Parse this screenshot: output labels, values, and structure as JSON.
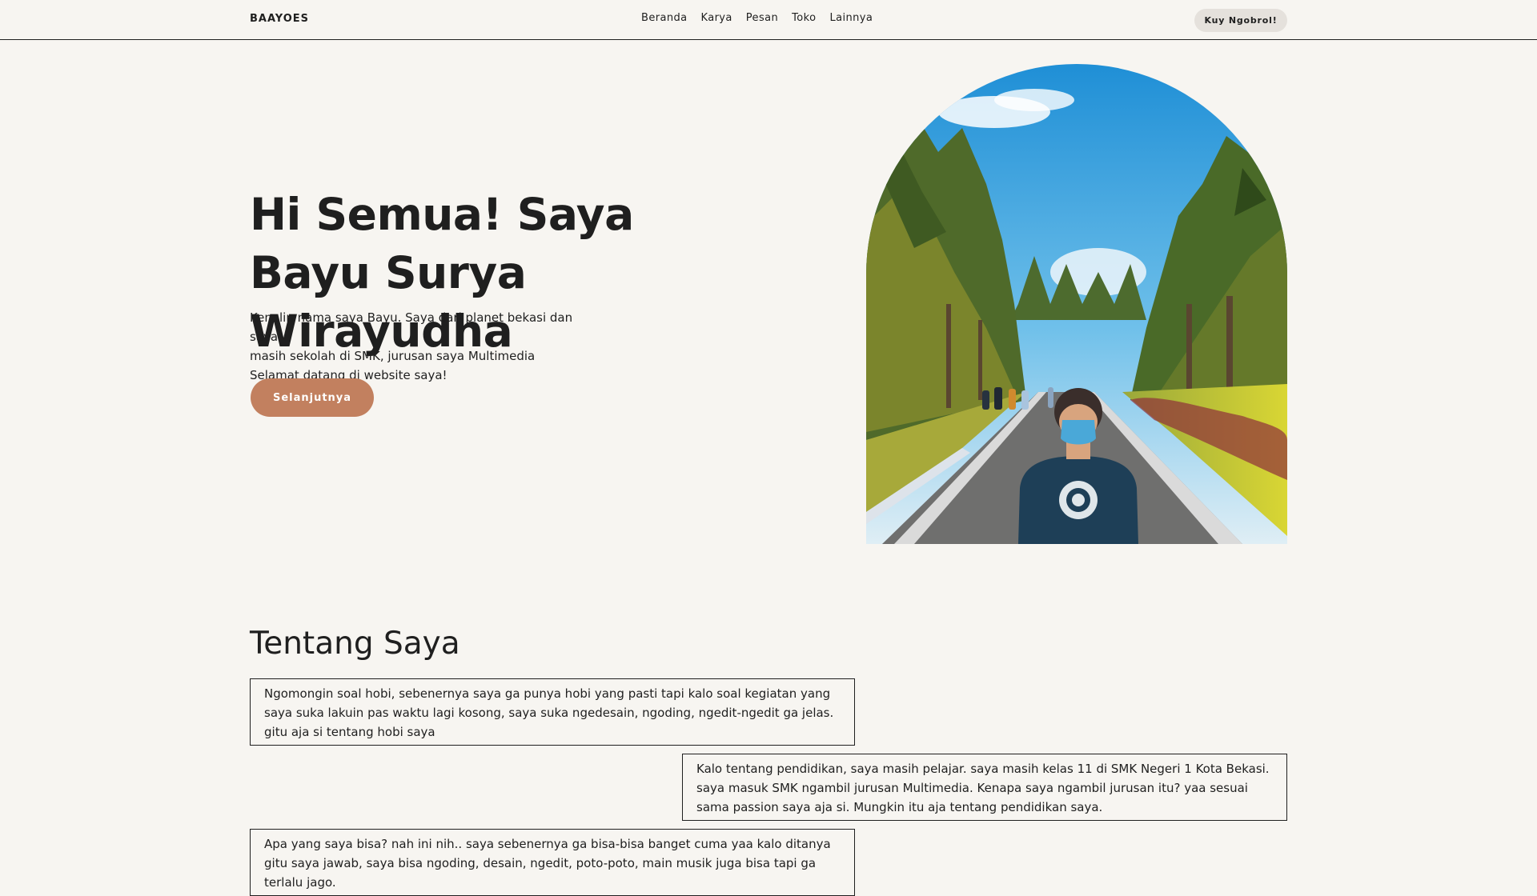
{
  "nav": {
    "brand": "BAAYOES",
    "links": [
      "Beranda",
      "Karya",
      "Pesan",
      "Toko",
      "Lainnya"
    ],
    "cta_label": "Kuy Ngobrol!"
  },
  "hero": {
    "title": "Hi Semua! Saya Bayu Surya Wirayudha",
    "description_lines": [
      "Kenalin nama saya Bayu. Saya dari planet bekasi dan saya",
      "masih sekolah di SMK, jurusan saya Multimedia",
      "Selamat datang di website saya!"
    ],
    "button_label": "Selanjutnya",
    "button_color": "#c2805f"
  },
  "about": {
    "title": "Tentang Saya",
    "cards": [
      "Ngomongin soal hobi, sebenernya saya ga punya hobi yang pasti tapi kalo soal kegiatan yang saya suka lakuin pas waktu lagi kosong, saya suka ngedesain, ngoding, ngedit-ngedit ga jelas. gitu aja si tentang hobi saya",
      "Kalo tentang pendidikan, saya masih pelajar. saya masih kelas 11 di SMK Negeri 1 Kota Bekasi. saya masuk SMK ngambil jurusan Multimedia. Kenapa saya ngambil jurusan itu? yaa sesuai sama passion saya aja si. Mungkin itu aja tentang pendidikan saya.",
      "Apa yang saya bisa? nah ini nih.. saya sebenernya ga bisa-bisa banget cuma yaa kalo ditanya gitu saya jawab, saya bisa ngoding, desain, ngedit, poto-poto, main musik juga bisa tapi ga terlalu jago."
    ]
  },
  "colors": {
    "background": "#f7f5f1",
    "text": "#1f1f1f",
    "accent": "#c2805f"
  }
}
